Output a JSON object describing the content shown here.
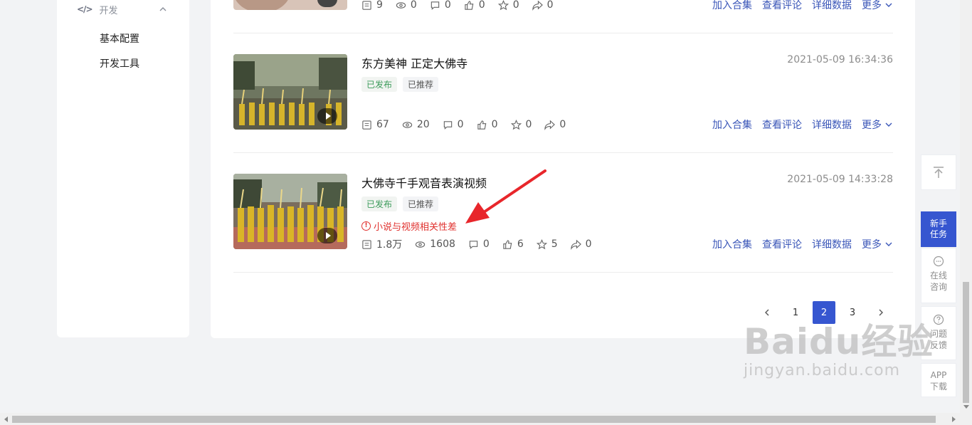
{
  "sidebar": {
    "group_icon": "</>",
    "group_label": "开发",
    "items": [
      {
        "label": "基本配置"
      },
      {
        "label": "开发工具"
      }
    ]
  },
  "videos": [
    {
      "title": "",
      "time": "",
      "tags": [],
      "warning": "",
      "stats": {
        "plays": "9",
        "views": "0",
        "comments": "0",
        "likes": "0",
        "favorites": "0",
        "shares": "0"
      }
    },
    {
      "title": "东方美神 正定大佛寺",
      "time": "2021-05-09 16:34:36",
      "tags": [
        "已发布",
        "已推荐"
      ],
      "warning": "",
      "stats": {
        "plays": "67",
        "views": "20",
        "comments": "0",
        "likes": "0",
        "favorites": "0",
        "shares": "0"
      }
    },
    {
      "title": "大佛寺千手观音表演视频",
      "time": "2021-05-09 14:33:28",
      "tags": [
        "已发布",
        "已推荐"
      ],
      "warning": "小说与视频相关性差",
      "stats": {
        "plays": "1.8万",
        "views": "1608",
        "comments": "0",
        "likes": "6",
        "favorites": "5",
        "shares": "0"
      }
    }
  ],
  "actions": {
    "add_collection": "加入合集",
    "view_comments": "查看评论",
    "details": "详细数据",
    "more": "更多"
  },
  "pagination": {
    "pages": [
      "1",
      "2",
      "3"
    ],
    "current": "2"
  },
  "tools": {
    "newbie_task": "新手任务",
    "online_consult": "在线咨询",
    "feedback": "问题反馈",
    "app_download": "APP下载"
  },
  "watermark": {
    "big": "Baidu经验",
    "small": "jingyan.baidu.com"
  },
  "colors": {
    "accent": "#3656d0",
    "warning": "#e0302d",
    "link": "#3a56b8",
    "published": "#3b9b5a"
  }
}
